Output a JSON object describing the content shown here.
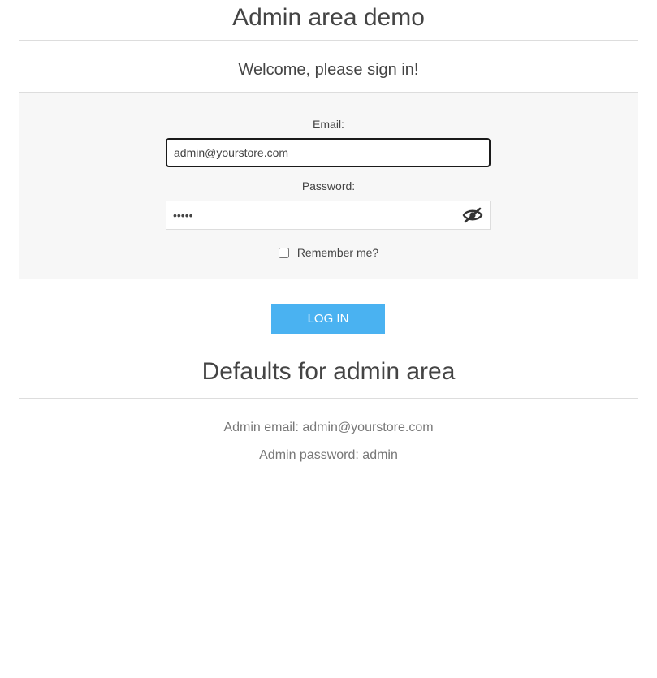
{
  "header": {
    "title": "Admin area demo"
  },
  "login": {
    "welcome": "Welcome, please sign in!",
    "email_label": "Email:",
    "email_value": "admin@yourstore.com",
    "password_label": "Password:",
    "password_value": "admin",
    "remember_label": "Remember me?",
    "remember_checked": false,
    "submit_label": "LOG IN",
    "password_toggle_icon": "eye-slash-icon"
  },
  "defaults": {
    "title": "Defaults for admin area",
    "email_line": "Admin email: admin@yourstore.com",
    "password_line": "Admin password: admin"
  },
  "colors": {
    "accent": "#4ab2f1",
    "panel_background": "#f7f7f7",
    "text": "#444444",
    "muted_text": "#777777",
    "rule": "#dddddd"
  }
}
